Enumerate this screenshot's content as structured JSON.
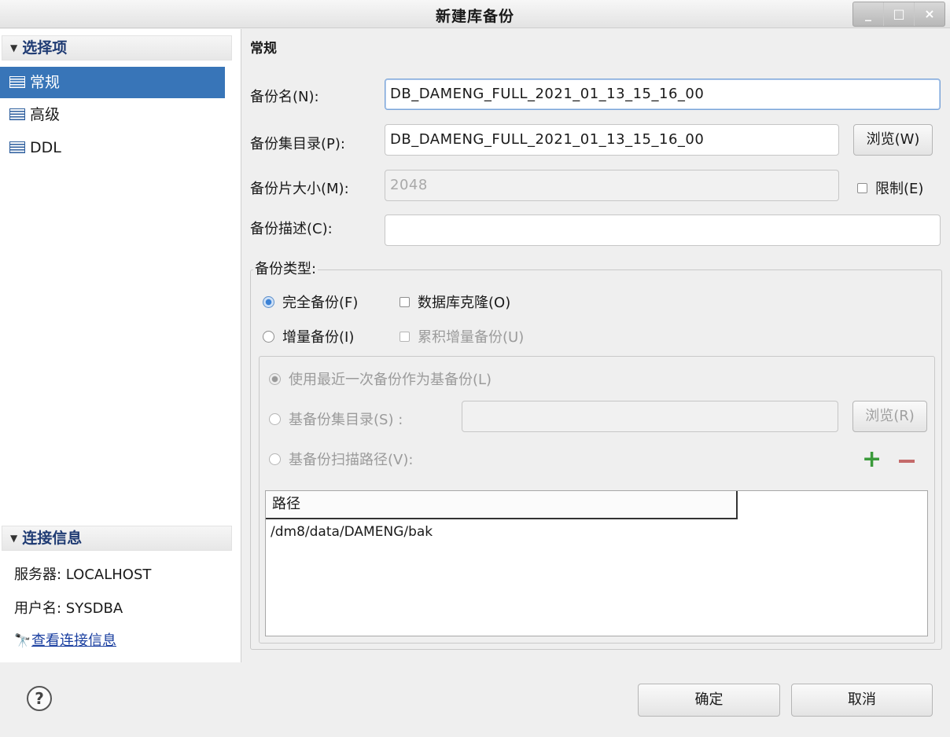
{
  "window": {
    "title": "新建库备份",
    "controls": [
      "_",
      "□",
      "×"
    ]
  },
  "left": {
    "section1": {
      "label": "选择项"
    },
    "nav": [
      {
        "label": "常规"
      },
      {
        "label": "高级"
      },
      {
        "label": "DDL"
      }
    ],
    "section2": {
      "label": "连接信息"
    },
    "server": "服务器: LOCALHOST",
    "user": "用户名: SYSDBA",
    "link": "查看连接信息"
  },
  "form": {
    "heading": "常规",
    "name_label": "备份名(N):",
    "name_value": "DB_DAMENG_FULL_2021_01_13_15_16_00",
    "dir_label": "备份集目录(P):",
    "dir_value": "DB_DAMENG_FULL_2021_01_13_15_16_00",
    "browse_label": "浏览(W)",
    "size_label": "备份片大小(M):",
    "size_value": "2048",
    "limit_label": "限制(E)",
    "desc_label": "备份描述(C):",
    "desc_value": "",
    "type_legend": "备份类型:",
    "full_label": "完全备份(F)",
    "clone_label": "数据库克隆(O)",
    "incr_label": "增量备份(I)",
    "cumulative_label": "累积增量备份(U)",
    "use_recent_label": "使用最近一次备份作为基备份(L)",
    "base_dir_label": "基备份集目录(S) :",
    "base_dir_value": "",
    "browse2_label": "浏览(R)",
    "scan_label": "基备份扫描路径(V):",
    "path_header": "路径",
    "paths": [
      "/dm8/data/DAMENG/bak"
    ]
  },
  "footer": {
    "ok_label": "确定",
    "cancel_label": "取消",
    "help": "?"
  }
}
